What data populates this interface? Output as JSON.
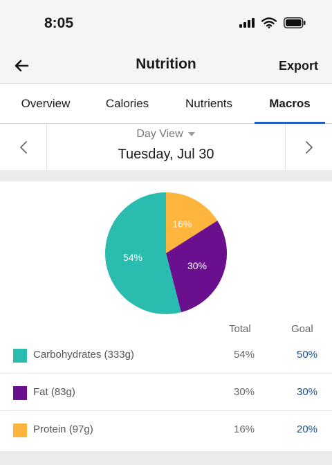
{
  "status_bar": {
    "time": "8:05"
  },
  "nav": {
    "title": "Nutrition",
    "export_label": "Export",
    "back_icon": "arrow-left-icon"
  },
  "tabs": [
    {
      "label": "Overview",
      "active": false
    },
    {
      "label": "Calories",
      "active": false
    },
    {
      "label": "Nutrients",
      "active": false
    },
    {
      "label": "Macros",
      "active": true
    }
  ],
  "day_nav": {
    "view_label": "Day View",
    "date": "Tuesday, Jul 30"
  },
  "macros_table": {
    "total_header": "Total",
    "goal_header": "Goal",
    "rows": [
      {
        "name": "Carbohydrates (333g)",
        "total": "54%",
        "goal": "50%",
        "color": "#2bbcb0"
      },
      {
        "name": "Fat (83g)",
        "total": "30%",
        "goal": "30%",
        "color": "#6a0f8e"
      },
      {
        "name": "Protein (97g)",
        "total": "16%",
        "goal": "20%",
        "color": "#fdb53e"
      }
    ]
  },
  "chart_data": {
    "type": "pie",
    "categories": [
      "Protein",
      "Fat",
      "Carbohydrates"
    ],
    "values": [
      16,
      30,
      54
    ],
    "labels": [
      "16%",
      "30%",
      "54%"
    ],
    "colors": [
      "#fdb53e",
      "#6a0f8e",
      "#2bbcb0"
    ],
    "title": ""
  }
}
